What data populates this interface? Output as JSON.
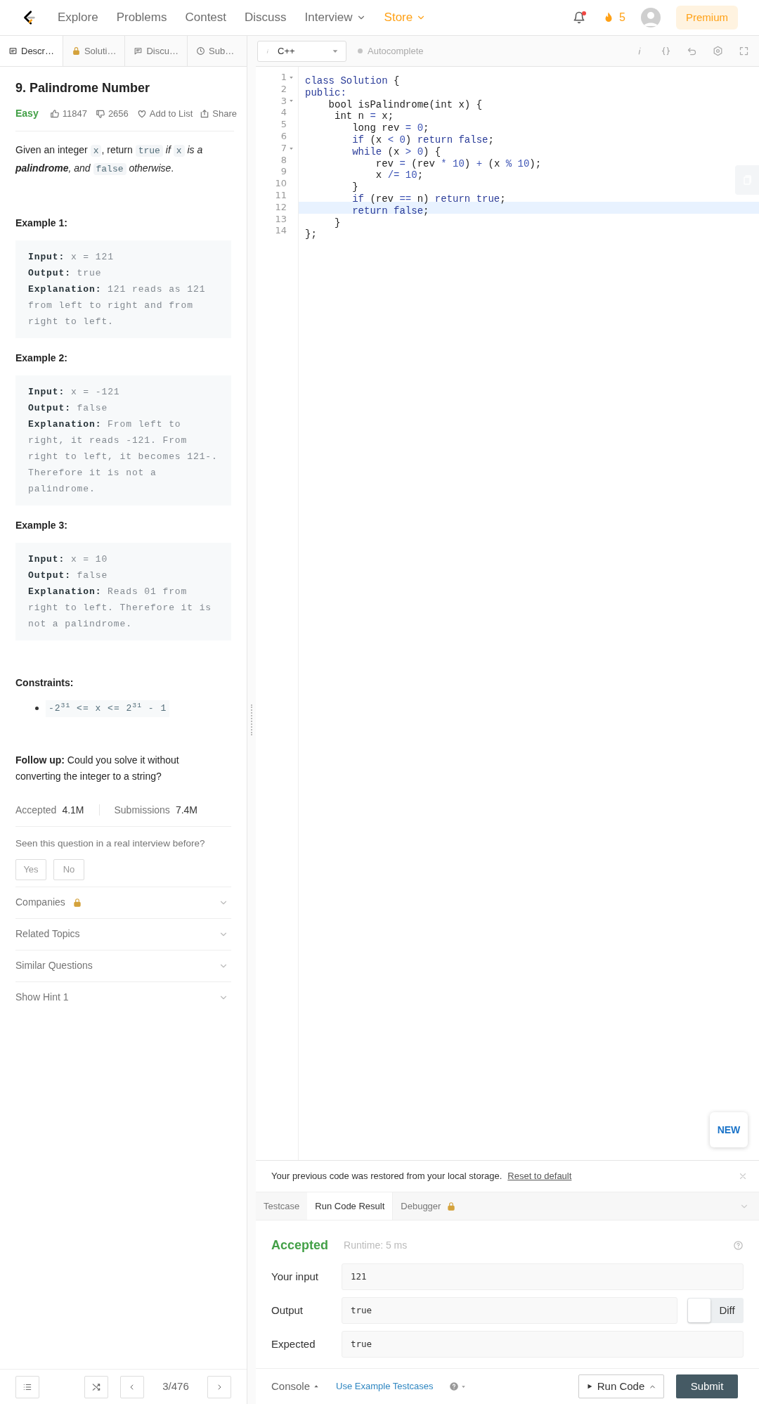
{
  "nav": {
    "links": [
      {
        "label": "Explore",
        "kind": "plain"
      },
      {
        "label": "Problems",
        "kind": "plain"
      },
      {
        "label": "Contest",
        "kind": "plain"
      },
      {
        "label": "Discuss",
        "kind": "plain"
      },
      {
        "label": "Interview",
        "kind": "dropdown"
      },
      {
        "label": "Store",
        "kind": "store"
      }
    ],
    "has_notification": true,
    "streak": "5",
    "premium": "Premium"
  },
  "tabs": [
    {
      "label": "Descr…",
      "kind": "description",
      "selected": true
    },
    {
      "label": "Soluti…",
      "kind": "locked",
      "selected": false
    },
    {
      "label": "Discu…",
      "kind": "discuss",
      "selected": false
    },
    {
      "label": "Sub…",
      "kind": "history",
      "selected": false
    }
  ],
  "problem": {
    "title": "9. Palindrome Number",
    "difficulty": "Easy",
    "likes": "11847",
    "dislikes": "2656",
    "add_to_list": "Add to List",
    "share": "Share",
    "description": [
      {
        "kind": "text",
        "text": "Given an integer "
      },
      {
        "kind": "code",
        "text": "x"
      },
      {
        "kind": "text",
        "text": ", return "
      },
      {
        "kind": "code",
        "text": "true"
      },
      {
        "kind": "text",
        "text": " *if* "
      },
      {
        "kind": "code",
        "text": "x"
      },
      {
        "kind": "text",
        "text": " *is a* "
      },
      {
        "kind": "text",
        "text": "**palindrome**"
      },
      {
        "kind": "text",
        "text": "*, and* "
      },
      {
        "kind": "code",
        "text": "false"
      },
      {
        "kind": "text",
        "text": " *otherwise*."
      }
    ],
    "examples": [
      {
        "heading": "Example 1:",
        "lines": [
          "**Input:** x = 121",
          "**Output:** true",
          "**Explanation:** 121 reads as 121 from left to right and from right to left."
        ]
      },
      {
        "heading": "Example 2:",
        "lines": [
          "**Input:** x = -121",
          "**Output:** false",
          "**Explanation:** From left to right, it reads -121. From right to left, it becomes 121-. Therefore it is not a palindrome."
        ]
      },
      {
        "heading": "Example 3:",
        "lines": [
          "**Input:** x = 10",
          "**Output:** false",
          "**Explanation:** Reads 01 from right to left. Therefore it is not a palindrome."
        ]
      }
    ],
    "constraints_heading": "Constraints:",
    "constraints": [
      "-2$^{31}$ <= x <= 2$^{31}$ - 1"
    ],
    "follow_up": "**Follow up:** Could you solve it without converting the integer to a string?",
    "accepted_label": "Accepted",
    "accepted": "4.1M",
    "submissions_label": "Submissions",
    "submissions": "7.4M",
    "seen_question": "Seen this question in a real interview before?",
    "answers": [
      "Yes",
      "No"
    ],
    "sections": [
      {
        "label": "Companies",
        "locked": true,
        "expanded": false
      },
      {
        "label": "Related Topics",
        "locked": false,
        "expanded": false
      },
      {
        "label": "Similar Questions",
        "locked": false,
        "expanded": false
      },
      {
        "label": "Show Hint 1",
        "locked": false,
        "expanded": false
      }
    ]
  },
  "pager": {
    "position": "3/476"
  },
  "editor": {
    "language": "C++",
    "autocomplete": {
      "label": "Autocomplete",
      "on": false
    },
    "lines": [
      {
        "number": "1",
        "foldable": true,
        "active": false,
        "tokens": [
          {
            "text": "class Solution",
            "kind": "keyword"
          },
          {
            "text": " {",
            "kind": "plain"
          }
        ]
      },
      {
        "number": "2",
        "foldable": false,
        "active": false,
        "tokens": [
          {
            "text": "public:",
            "kind": "keyword"
          }
        ]
      },
      {
        "number": "3",
        "foldable": true,
        "active": false,
        "tokens": [
          {
            "text": "    bool isPalindrome(int x) {",
            "kind": "plain"
          }
        ]
      },
      {
        "number": "4",
        "foldable": false,
        "active": false,
        "tokens": [
          {
            "text": "     int n ",
            "kind": "plain"
          },
          {
            "text": "=",
            "kind": "literal"
          },
          {
            "text": " x;",
            "kind": "plain"
          }
        ]
      },
      {
        "number": "5",
        "foldable": false,
        "active": false,
        "tokens": [
          {
            "text": "        long rev ",
            "kind": "plain"
          },
          {
            "text": "= 0",
            "kind": "literal"
          },
          {
            "text": ";",
            "kind": "plain"
          }
        ]
      },
      {
        "number": "6",
        "foldable": false,
        "active": false,
        "tokens": [
          {
            "text": "        if",
            "kind": "keyword"
          },
          {
            "text": " (x ",
            "kind": "plain"
          },
          {
            "text": "< 0",
            "kind": "literal"
          },
          {
            "text": ") ",
            "kind": "plain"
          },
          {
            "text": "return false",
            "kind": "keyword"
          },
          {
            "text": ";",
            "kind": "plain"
          }
        ]
      },
      {
        "number": "7",
        "foldable": true,
        "active": false,
        "tokens": [
          {
            "text": "        while",
            "kind": "keyword"
          },
          {
            "text": " (x ",
            "kind": "plain"
          },
          {
            "text": "> 0",
            "kind": "literal"
          },
          {
            "text": ") {",
            "kind": "plain"
          }
        ]
      },
      {
        "number": "8",
        "foldable": false,
        "active": false,
        "tokens": [
          {
            "text": "            rev ",
            "kind": "plain"
          },
          {
            "text": "=",
            "kind": "literal"
          },
          {
            "text": " (rev ",
            "kind": "plain"
          },
          {
            "text": "* 10",
            "kind": "literal"
          },
          {
            "text": ") ",
            "kind": "plain"
          },
          {
            "text": "+",
            "kind": "literal"
          },
          {
            "text": " (x ",
            "kind": "plain"
          },
          {
            "text": "% 10",
            "kind": "literal"
          },
          {
            "text": ");",
            "kind": "plain"
          }
        ]
      },
      {
        "number": "9",
        "foldable": false,
        "active": false,
        "tokens": [
          {
            "text": "            x ",
            "kind": "plain"
          },
          {
            "text": "/= 10",
            "kind": "literal"
          },
          {
            "text": ";",
            "kind": "plain"
          }
        ]
      },
      {
        "number": "10",
        "foldable": false,
        "active": false,
        "tokens": [
          {
            "text": "        }",
            "kind": "plain"
          }
        ]
      },
      {
        "number": "11",
        "foldable": false,
        "active": false,
        "tokens": [
          {
            "text": "        if",
            "kind": "keyword"
          },
          {
            "text": " (rev ",
            "kind": "plain"
          },
          {
            "text": "==",
            "kind": "literal"
          },
          {
            "text": " n) ",
            "kind": "plain"
          },
          {
            "text": "return true",
            "kind": "keyword"
          },
          {
            "text": ";",
            "kind": "plain"
          }
        ]
      },
      {
        "number": "12",
        "foldable": false,
        "active": true,
        "tokens": [
          {
            "text": "        return false",
            "kind": "keyword"
          },
          {
            "text": ";",
            "kind": "plain"
          }
        ]
      },
      {
        "number": "13",
        "foldable": false,
        "active": false,
        "tokens": [
          {
            "text": "     }",
            "kind": "plain"
          }
        ]
      },
      {
        "number": "14",
        "foldable": false,
        "active": false,
        "tokens": [
          {
            "text": "};",
            "kind": "plain"
          }
        ]
      }
    ],
    "new_badge": "NEW"
  },
  "notice": {
    "text": "Your previous code was restored from your local storage.",
    "link": "Reset to default"
  },
  "console_tabs": [
    {
      "label": "Testcase",
      "locked": false,
      "selected": false
    },
    {
      "label": "Run Code Result",
      "locked": false,
      "selected": true
    },
    {
      "label": "Debugger",
      "locked": true,
      "selected": false
    }
  ],
  "result": {
    "status": "Accepted",
    "runtime": "Runtime: 5 ms",
    "rows": [
      {
        "label": "Your input",
        "value": "121"
      },
      {
        "label": "Output",
        "value": "true",
        "diff": {
          "label": "Diff",
          "on": false
        }
      },
      {
        "label": "Expected",
        "value": "true"
      }
    ]
  },
  "footer": {
    "console": "Console",
    "example_testcases": "Use Example Testcases",
    "run_code": "Run Code",
    "submit": "Submit"
  }
}
